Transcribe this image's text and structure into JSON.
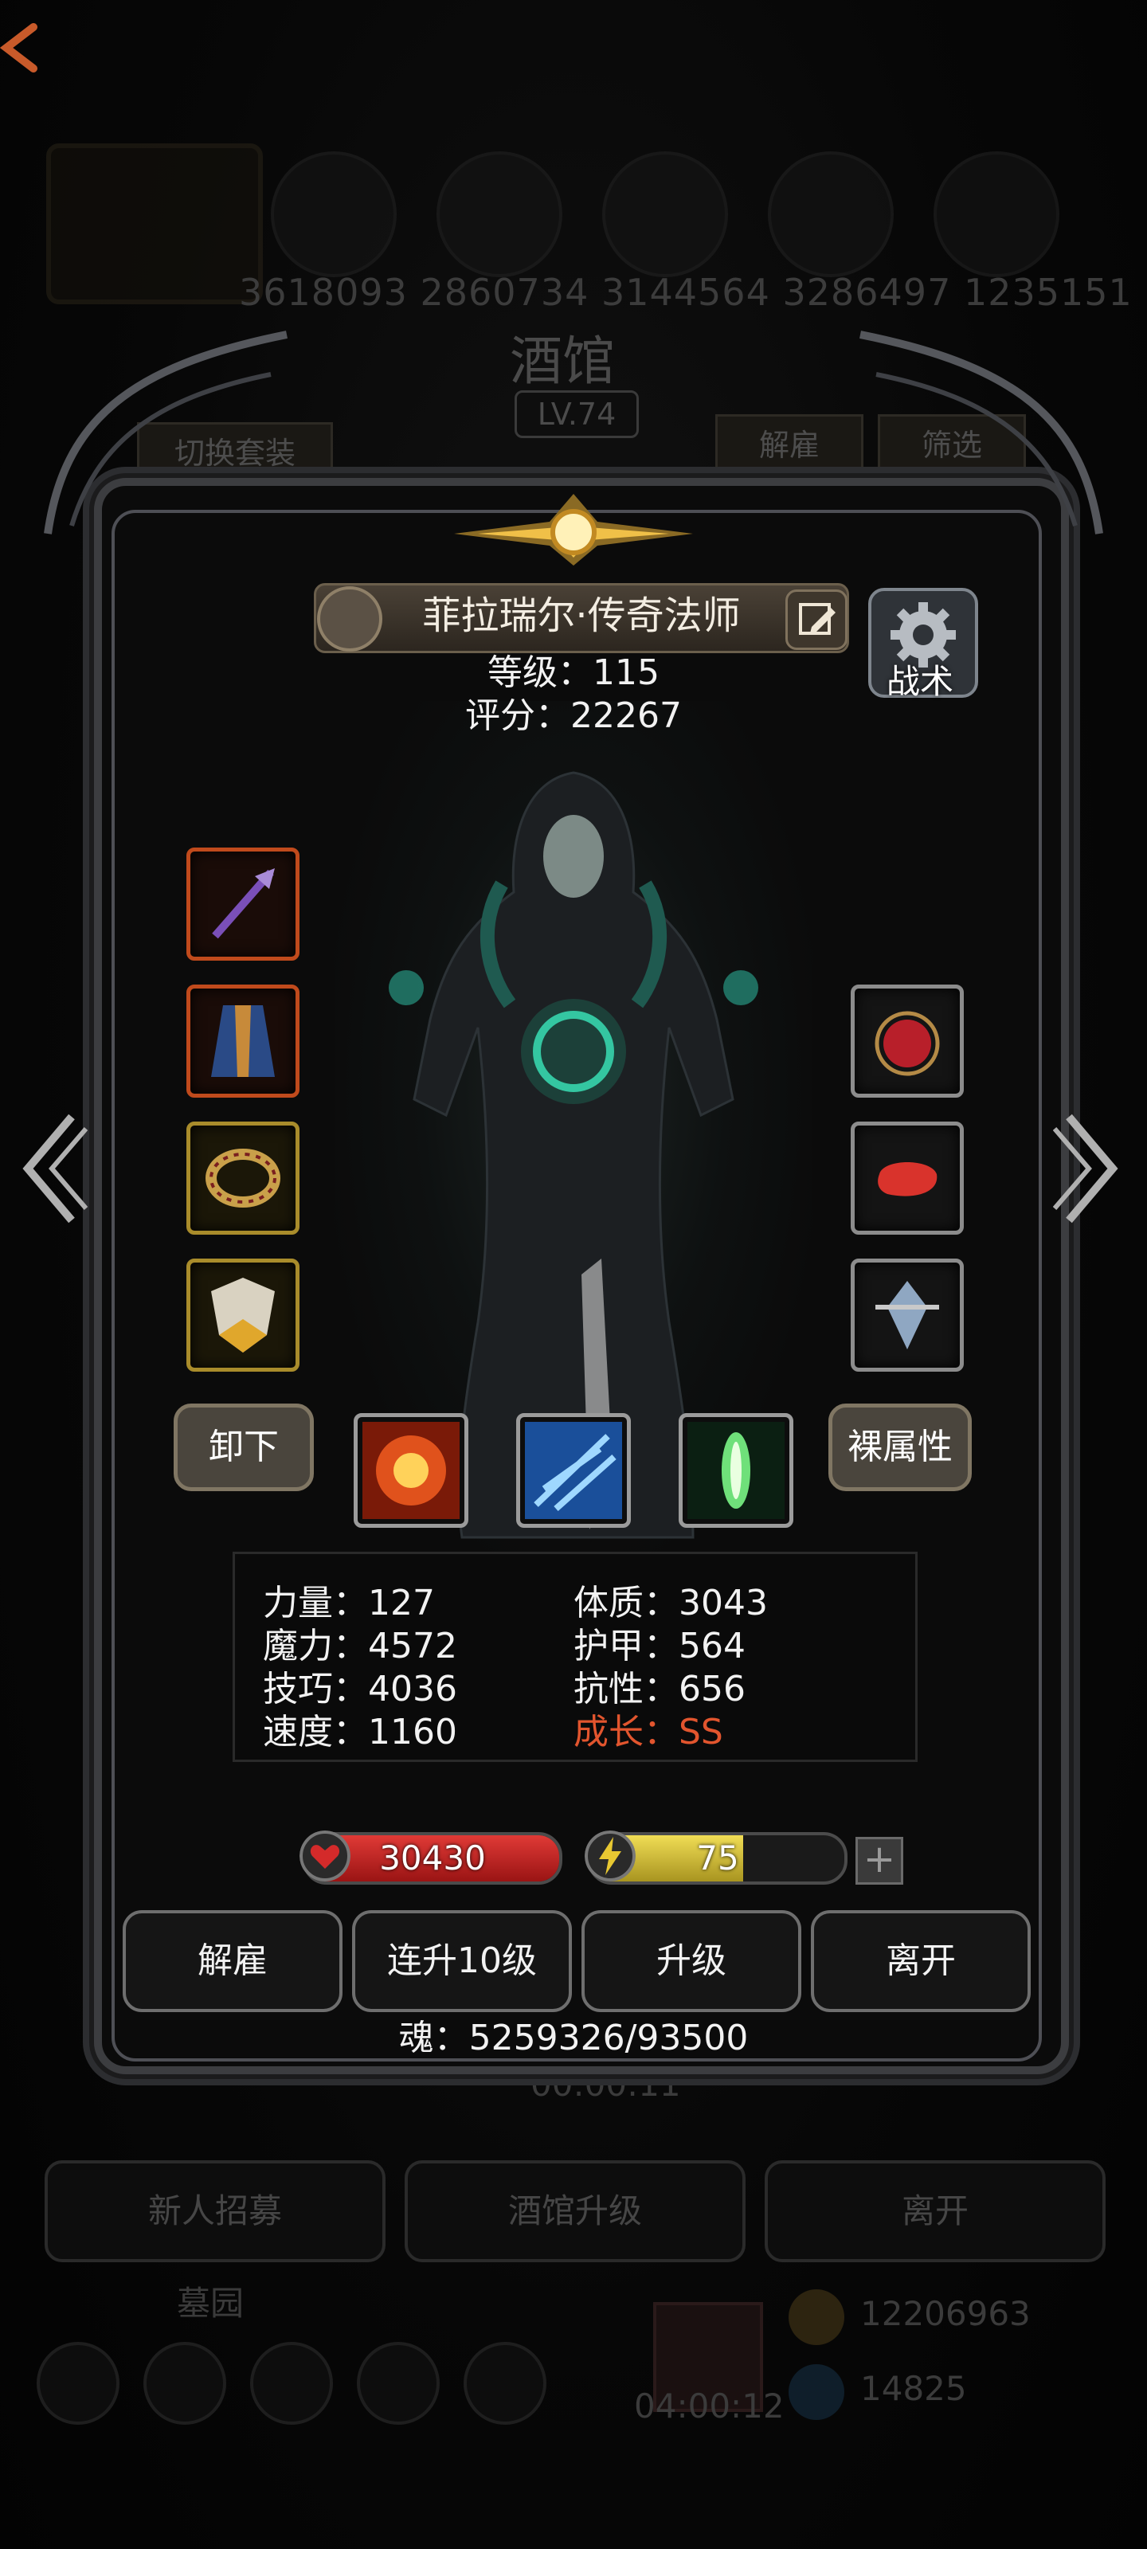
{
  "background": {
    "numbers": "3618093 2860734 3144564 3286497 1235151",
    "title": "酒馆",
    "level": "LV.74",
    "tabs": {
      "switch_set": "切换套装",
      "dismiss": "解雇",
      "filter": "筛选"
    },
    "timer": "00:00:11",
    "buttons": {
      "recruit": "新人招募",
      "upgrade_tavern": "酒馆升级",
      "leave": "离开"
    },
    "section_label": "墓园",
    "gold": "12206963",
    "gem": "14825",
    "bottom_timer": "04:00:12"
  },
  "hero": {
    "name": "菲拉瑞尔·传奇法师",
    "level_label": "等级：115",
    "score_label": "评分：22267"
  },
  "tactics": {
    "label": "战术"
  },
  "actions": {
    "unequip": "卸下",
    "naked_attrs": "裸属性"
  },
  "attributes": {
    "strength": "力量：127",
    "physique": "体质：3043",
    "magic": "魔力：4572",
    "armor": "护甲：564",
    "skill": "技巧：4036",
    "resistance": "抗性：656",
    "speed": "速度：1160",
    "growth": "成长：SS"
  },
  "resources": {
    "hp": "30430",
    "energy": "75",
    "energy_fraction": 0.6
  },
  "buttons": {
    "dismiss": "解雇",
    "level_up_10": "连升10级",
    "level_up": "升级",
    "leave": "离开"
  },
  "soul": "魂：5259326/93500",
  "colors": {
    "growth": "#e2552e",
    "hp_bar": "#c0201f",
    "energy_bar": "#d6c23a"
  }
}
